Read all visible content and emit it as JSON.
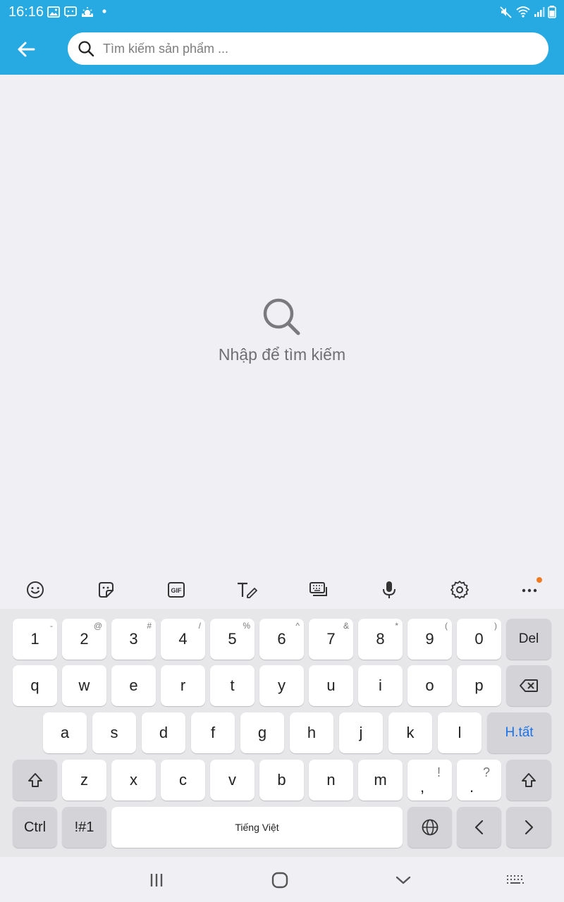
{
  "status_bar": {
    "time": "16:16",
    "left_icons": [
      "image-icon",
      "messenger-icon",
      "weather-icon",
      "dot-icon"
    ],
    "right_icons": [
      "mute-icon",
      "wifi-icon",
      "signal-icon",
      "battery-icon"
    ]
  },
  "header": {
    "back_icon": "arrow-left-icon",
    "search_placeholder": "Tìm kiếm sản phẩm ...",
    "search_value": ""
  },
  "empty_state": {
    "icon": "search-icon",
    "text": "Nhập để tìm kiếm"
  },
  "keyboard_toolbar": {
    "items": [
      "emoji-icon",
      "sticker-icon",
      "gif-icon",
      "handwriting-icon",
      "keyboard-mode-icon",
      "mic-icon",
      "settings-icon",
      "more-icon"
    ]
  },
  "keyboard": {
    "number_row": [
      {
        "main": "1",
        "sup": "-"
      },
      {
        "main": "2",
        "sup": "@"
      },
      {
        "main": "3",
        "sup": "#"
      },
      {
        "main": "4",
        "sup": "/"
      },
      {
        "main": "5",
        "sup": "%"
      },
      {
        "main": "6",
        "sup": "^"
      },
      {
        "main": "7",
        "sup": "&"
      },
      {
        "main": "8",
        "sup": "*"
      },
      {
        "main": "9",
        "sup": "("
      },
      {
        "main": "0",
        "sup": ")"
      }
    ],
    "del_label": "Del",
    "row_q": [
      "q",
      "w",
      "e",
      "r",
      "t",
      "y",
      "u",
      "i",
      "o",
      "p"
    ],
    "row_a": [
      "a",
      "s",
      "d",
      "f",
      "g",
      "h",
      "j",
      "k",
      "l"
    ],
    "done_label": "H.tất",
    "row_z": [
      "z",
      "x",
      "c",
      "v",
      "b",
      "n",
      "m"
    ],
    "comma_key": {
      "main": ",",
      "sup": "!"
    },
    "period_key": {
      "main": ".",
      "sup": "?"
    },
    "ctrl_label": "Ctrl",
    "symbols_label": "!#1",
    "space_label": "Tiếng Việt",
    "colors": {
      "accent": "#27a9e1",
      "done": "#1a73e8",
      "notify_dot": "#f07a20"
    }
  },
  "nav_bar": {
    "items": [
      "recents-icon",
      "home-icon",
      "hide-keyboard-icon",
      "keyboard-switch-icon"
    ]
  }
}
